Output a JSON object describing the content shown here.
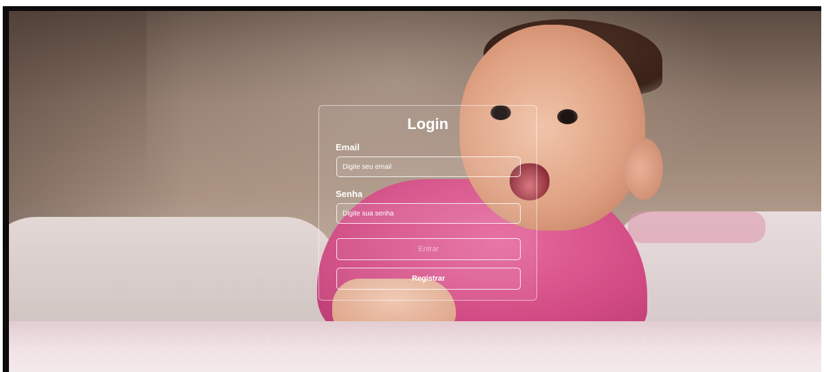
{
  "login": {
    "title": "Login",
    "email_label": "Email",
    "email_placeholder": "Digite seu email",
    "password_label": "Senha",
    "password_placeholder": "Digite sua senha",
    "submit_label": "Entrar",
    "register_label": "Registrar"
  },
  "colors": {
    "card_border": "#ffffff",
    "text": "#ffffff"
  }
}
